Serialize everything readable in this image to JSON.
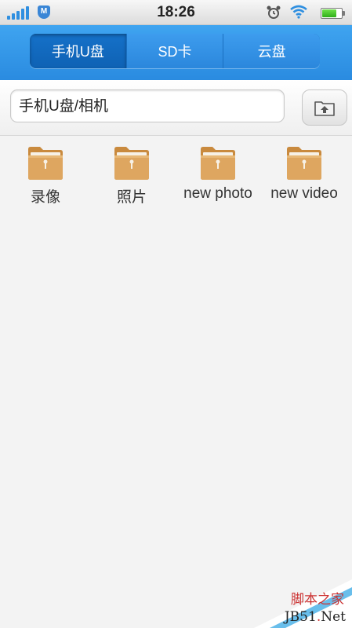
{
  "status_bar": {
    "time": "18:26",
    "icons": [
      "signal-icon",
      "app-badge-icon",
      "alarm-icon",
      "wifi-icon",
      "battery-icon"
    ],
    "app_badge_letter": "M",
    "battery_level": 0.7
  },
  "tabs": [
    {
      "label": "手机U盘",
      "active": true
    },
    {
      "label": "SD卡",
      "active": false
    },
    {
      "label": "云盘",
      "active": false
    }
  ],
  "path_bar": {
    "path": "手机U盘/相机",
    "up_icon": "folder-up-icon"
  },
  "folders": [
    {
      "label": "录像"
    },
    {
      "label": "照片"
    },
    {
      "label": "new photo"
    },
    {
      "label": "new video"
    }
  ],
  "watermark": {
    "line1": "脚本之家",
    "line2_a": "JB51",
    "line2_b": ".",
    "line2_c": "Net"
  },
  "colors": {
    "header_blue": "#2a8be0",
    "folder": "#d9a25a"
  }
}
